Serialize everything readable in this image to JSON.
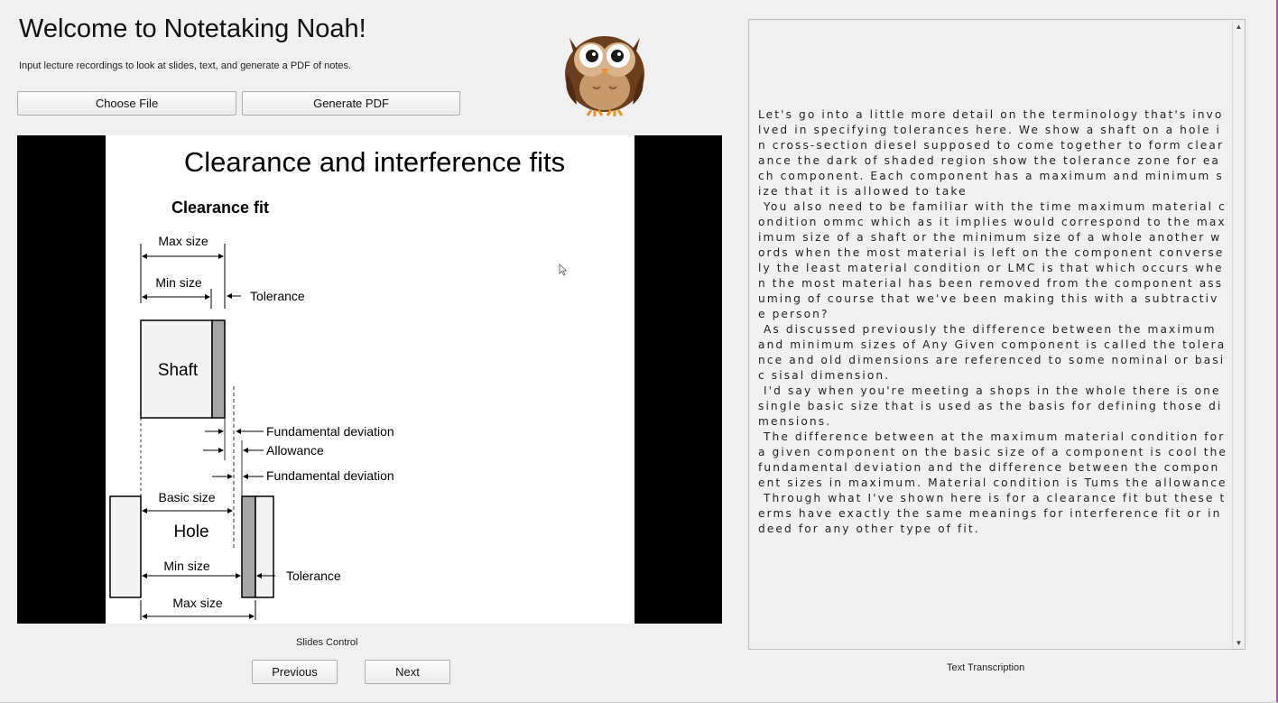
{
  "header": {
    "title": "Welcome to Notetaking Noah!",
    "subtitle": "Input lecture recordings to look at slides, text, and generate a PDF of notes."
  },
  "toolbar": {
    "choose_file_label": "Choose File",
    "generate_pdf_label": "Generate PDF"
  },
  "slide": {
    "title": "Clearance and interference fits",
    "subtitle": "Clearance fit",
    "labels": {
      "max_size_top": "Max size",
      "min_size_top": "Min size",
      "tolerance_top": "Tolerance",
      "shaft": "Shaft",
      "fundamental_deviation_1": "Fundamental deviation",
      "allowance": "Allowance",
      "fundamental_deviation_2": "Fundamental deviation",
      "basic_size": "Basic size",
      "hole": "Hole",
      "min_size_bottom": "Min size",
      "tolerance_bottom": "Tolerance",
      "max_size_bottom": "Max size"
    }
  },
  "slides_control": {
    "label": "Slides Control",
    "previous_label": "Previous",
    "next_label": "Next"
  },
  "transcription": {
    "label": "Text Transcription",
    "text": "Let's go into a little more detail on the terminology that's involved in specifying tolerances here. We show a shaft on a hole in cross-section diesel supposed to come together to form clearance the dark of shaded region show the tolerance zone for each component. Each component has a maximum and minimum size that it is allowed to take\n You also need to be familiar with the time maximum material condition ommc which as it implies would correspond to the maximum size of a shaft or the minimum size of a whole another words when the most material is left on the component conversely the least material condition or LMC is that which occurs when the most material has been removed from the component assuming of course that we've been making this with a subtractive person?\n As discussed previously the difference between the maximum and minimum sizes of Any Given component is called the tolerance and old dimensions are referenced to some nominal or basic sisal dimension.\n I'd say when you're meeting a shops in the whole there is one single basic size that is used as the basis for defining those dimensions.\n The difference between at the maximum material condition for a given component on the basic size of a component is cool the fundamental deviation and the difference between the component sizes in maximum. Material condition is Tums the allowance\n Through what I've shown here is for a clearance fit but these terms have exactly the same meanings for interference fit or indeed for any other type of fit."
  },
  "icons": {
    "owl": "owl-mascot-icon",
    "cursor": "mouse-cursor-icon",
    "scroll_up": "scroll-up-arrow-icon",
    "scroll_down": "scroll-down-arrow-icon"
  },
  "colors": {
    "background": "#f0f0f0",
    "slide_frame": "#000000",
    "tolerance_fill": "#a6a6a6",
    "part_fill": "#efefef"
  }
}
